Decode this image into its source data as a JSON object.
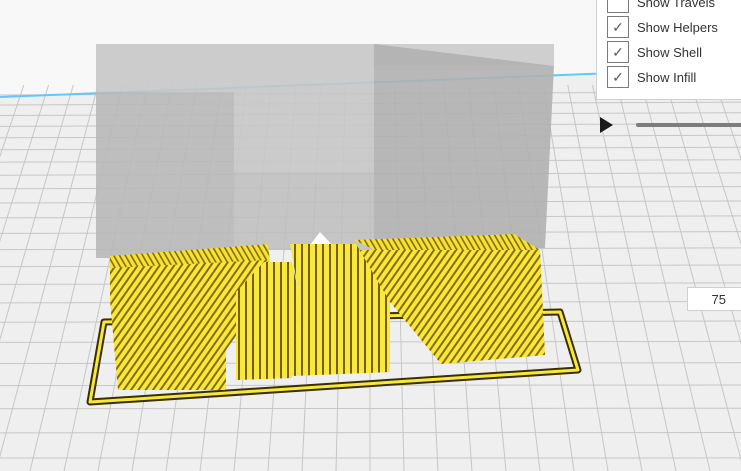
{
  "view_options": {
    "items": [
      {
        "label": "Show Travels",
        "checked": false
      },
      {
        "label": "Show Helpers",
        "checked": true
      },
      {
        "label": "Show Shell",
        "checked": true
      },
      {
        "label": "Show Infill",
        "checked": true
      }
    ],
    "check_glyph": "✓"
  },
  "simulation": {
    "play_icon": "play-icon"
  },
  "layer": {
    "value": "75"
  },
  "colors": {
    "build_plate": "#efefef",
    "grid_line": "#c8c8c8",
    "model_shell": "#b5b5b5",
    "infill": "#f6e83c",
    "infill_dark": "#8a6c00",
    "plate_edge": "#5fc8ff"
  }
}
